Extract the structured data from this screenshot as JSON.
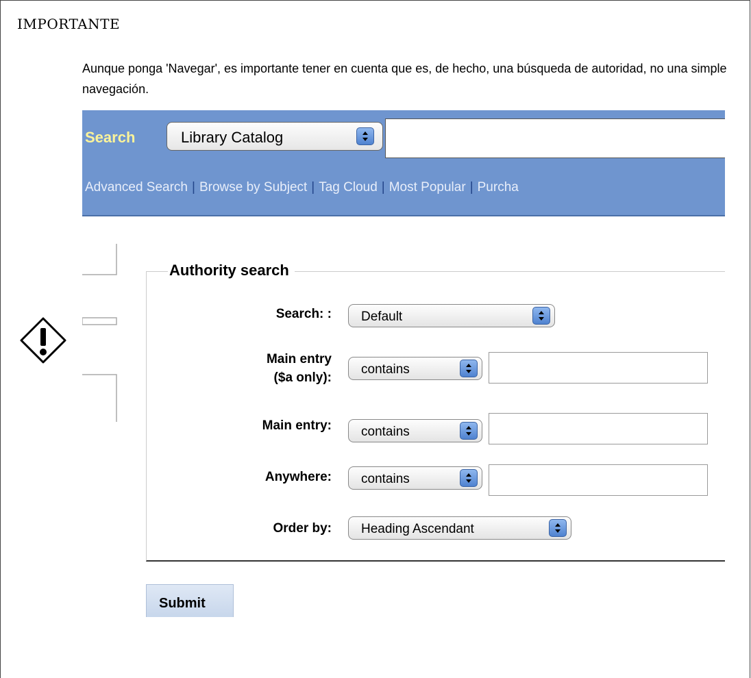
{
  "admonition": {
    "title": "IMPORTANTE",
    "text": "Aunque ponga 'Navegar', es importante tener en cuenta que es, de hecho, una búsqueda de autoridad, no una simple navegación."
  },
  "screenshot": {
    "search_label": "Search",
    "catalog_select": "Library Catalog",
    "search_value": "",
    "nav_links": [
      "Advanced Search",
      "Browse by Subject",
      "Tag Cloud",
      "Most Popular",
      "Purcha"
    ],
    "authority": {
      "legend": "Authority search",
      "search_label": "Search: :",
      "search_select": "Default",
      "main_entry_a_label": "Main entry ($a only):",
      "main_entry_a_select": "contains",
      "main_entry_label": "Main entry:",
      "main_entry_select": "contains",
      "anywhere_label": "Anywhere:",
      "anywhere_select": "contains",
      "order_label": "Order by:",
      "order_select": "Heading Ascendant",
      "submit": "Submit"
    }
  },
  "colors": {
    "topbar": "#6f95cf",
    "search_label": "#fbf39a",
    "link": "#e8eefa",
    "separator": "#23458a"
  },
  "icons": {
    "warning": "exclamation-diamond-icon",
    "stepper": "up-down-arrows-icon"
  }
}
